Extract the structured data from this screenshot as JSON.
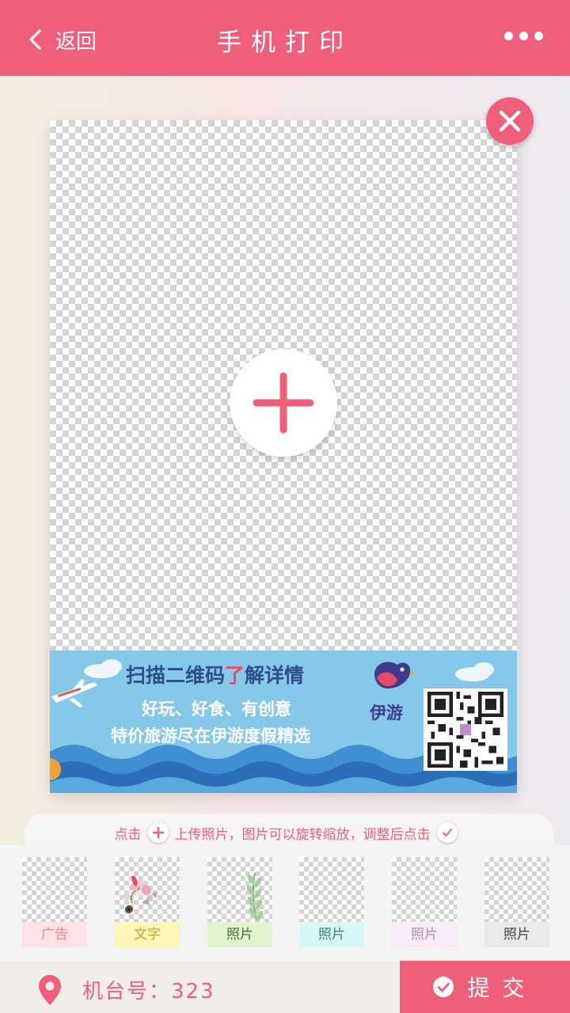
{
  "header": {
    "back_label": "返回",
    "title": "手机打印"
  },
  "banner": {
    "line1_a": "扫描二维码",
    "line1_b": "了",
    "line1_c": "解详情",
    "line2": "好玩、好食、有创意",
    "line3": "特价旅游尽在伊游度假精选",
    "logo_text": "伊游"
  },
  "tip": {
    "part1": "点击",
    "part2": "上传照片，图片可以旋转缩放，调整后点击"
  },
  "thumbnails": [
    {
      "label": "广告",
      "label_color": "#f08a8a",
      "bg": "#fde3e6"
    },
    {
      "label": "文字",
      "label_color": "#c2a531",
      "bg": "#fdf6b6"
    },
    {
      "label": "照片",
      "label_color": "#4a6d2f",
      "bg": "#e0f5cd"
    },
    {
      "label": "照片",
      "label_color": "#3b7f80",
      "bg": "#d5f7f6"
    },
    {
      "label": "照片",
      "label_color": "#b78ab8",
      "bg": "#f9ebf8"
    },
    {
      "label": "照片",
      "label_color": "#444444",
      "bg": "#e9e9e9"
    }
  ],
  "footer": {
    "machine_label": "机台号：323",
    "submit_label": "提交"
  },
  "colors": {
    "accent": "#ef5f7a"
  }
}
